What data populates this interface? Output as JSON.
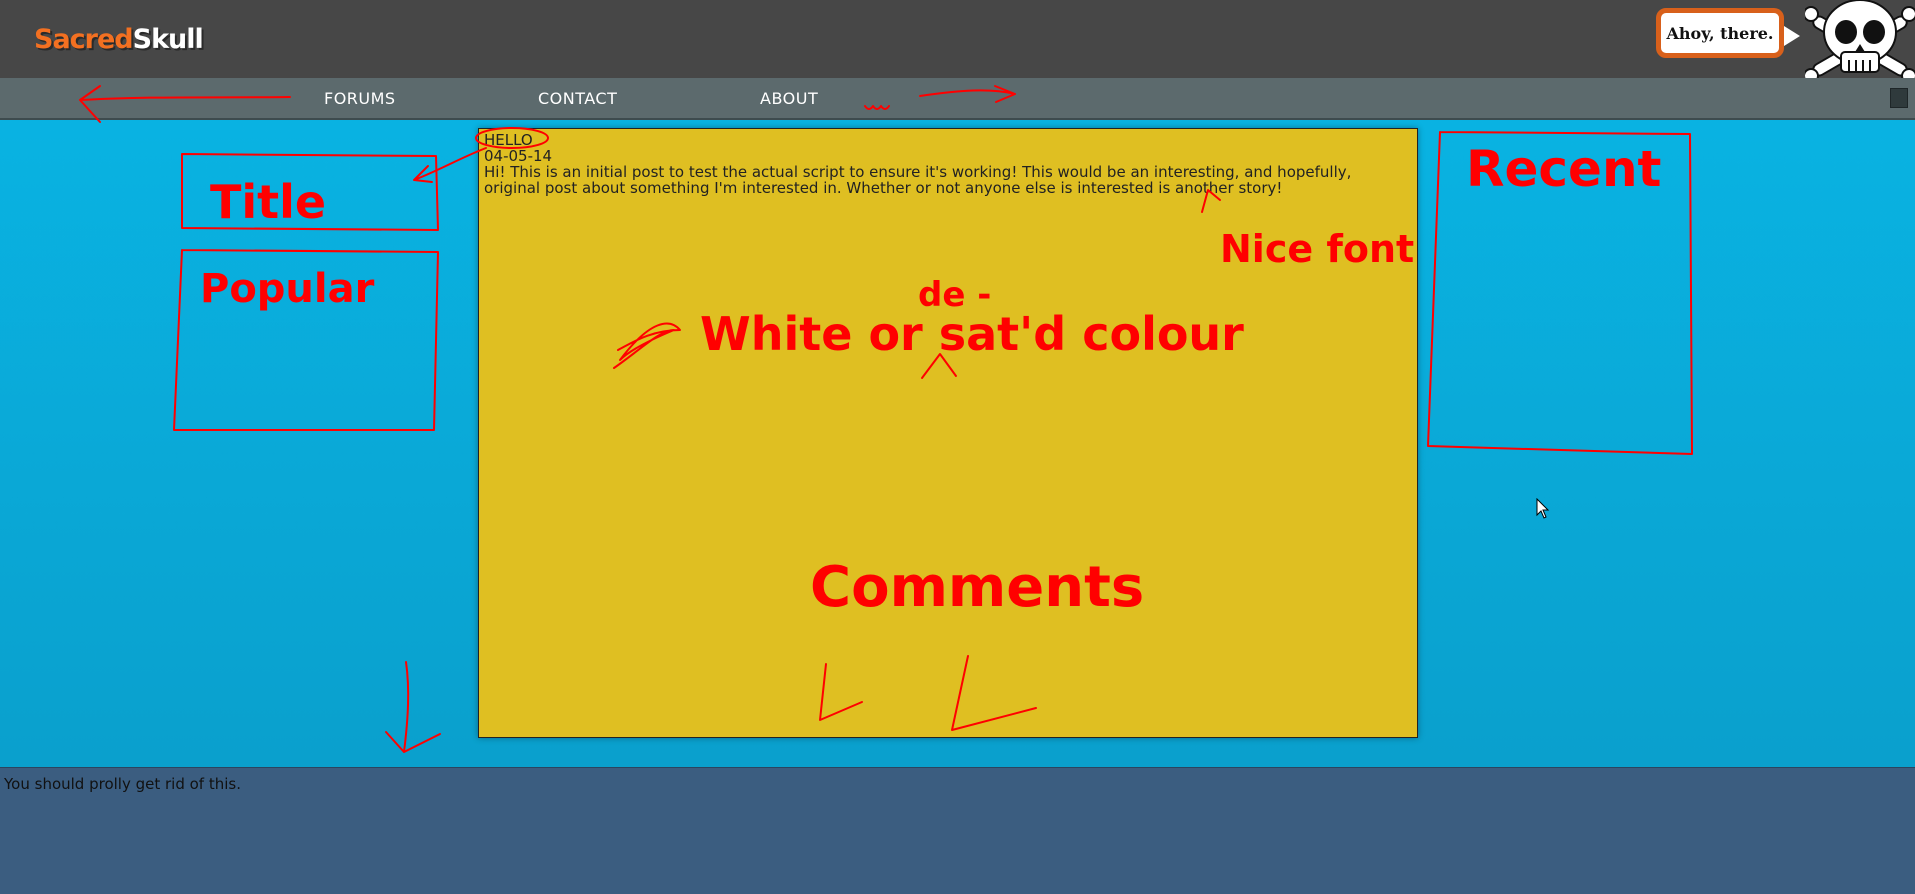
{
  "header": {
    "logo_part1": "Sacred",
    "logo_part2": "Skull",
    "greeting": "Ahoy, there."
  },
  "nav": {
    "items": [
      {
        "label": "FORUMS"
      },
      {
        "label": "CONTACT"
      },
      {
        "label": "ABOUT"
      }
    ]
  },
  "post": {
    "title": "HELLO",
    "date": "04-05-14",
    "body": "Hi! This is an initial post to test the actual script to ensure it's working! This would be an interesting, and hopefully, original post about something I'm interested in. Whether or not anyone else is interested is another story!"
  },
  "footer": {
    "text": "You should prolly get rid of this."
  },
  "annotations": {
    "color": "#ff0000",
    "title_box": "Title",
    "popular_box": "Popular",
    "recent_box": "Recent",
    "nice_font": "Nice font",
    "colour_note": "White or sat'd colour",
    "de_insert": "de -",
    "comments": "Comments"
  },
  "colors": {
    "header_bg": "#474747",
    "nav_bg": "#5c6a6d",
    "page_bg": "#09b6e6",
    "post_bg": "#dfbf22",
    "footer_bg": "#3b5d80",
    "logo_accent": "#f37021"
  }
}
